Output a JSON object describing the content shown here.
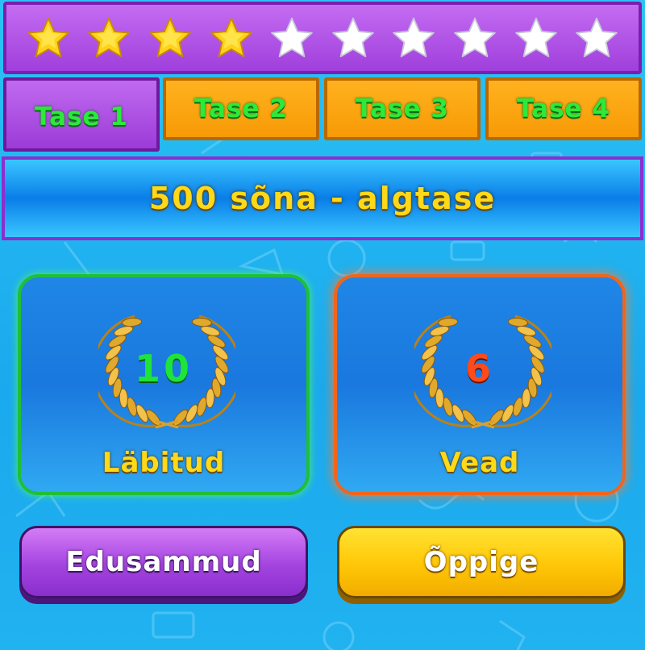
{
  "rating": {
    "filled": 4,
    "total": 10,
    "filled_color": "#ffd21a",
    "empty_color": "#ffffff",
    "icon": "star-icon"
  },
  "levels": {
    "active_index": 0,
    "tabs": [
      {
        "label": "Tase 1"
      },
      {
        "label": "Tase 2"
      },
      {
        "label": "Tase 3"
      },
      {
        "label": "Tase 4"
      }
    ]
  },
  "banner": {
    "title": "500 sõna - algtase"
  },
  "stats": {
    "completed": {
      "value": "10",
      "label": "Läbitud",
      "icon": "laurel-wreath-icon"
    },
    "mistakes": {
      "value": "6",
      "label": "Vead",
      "icon": "laurel-wreath-icon"
    }
  },
  "buttons": {
    "progress": "Edusammud",
    "learn": "Õppige"
  },
  "colors": {
    "purple": "#a444e0",
    "orange": "#f79a06",
    "green_text": "#2bea3a",
    "yellow_text": "#ffd818",
    "background": "#1aa9ee"
  }
}
